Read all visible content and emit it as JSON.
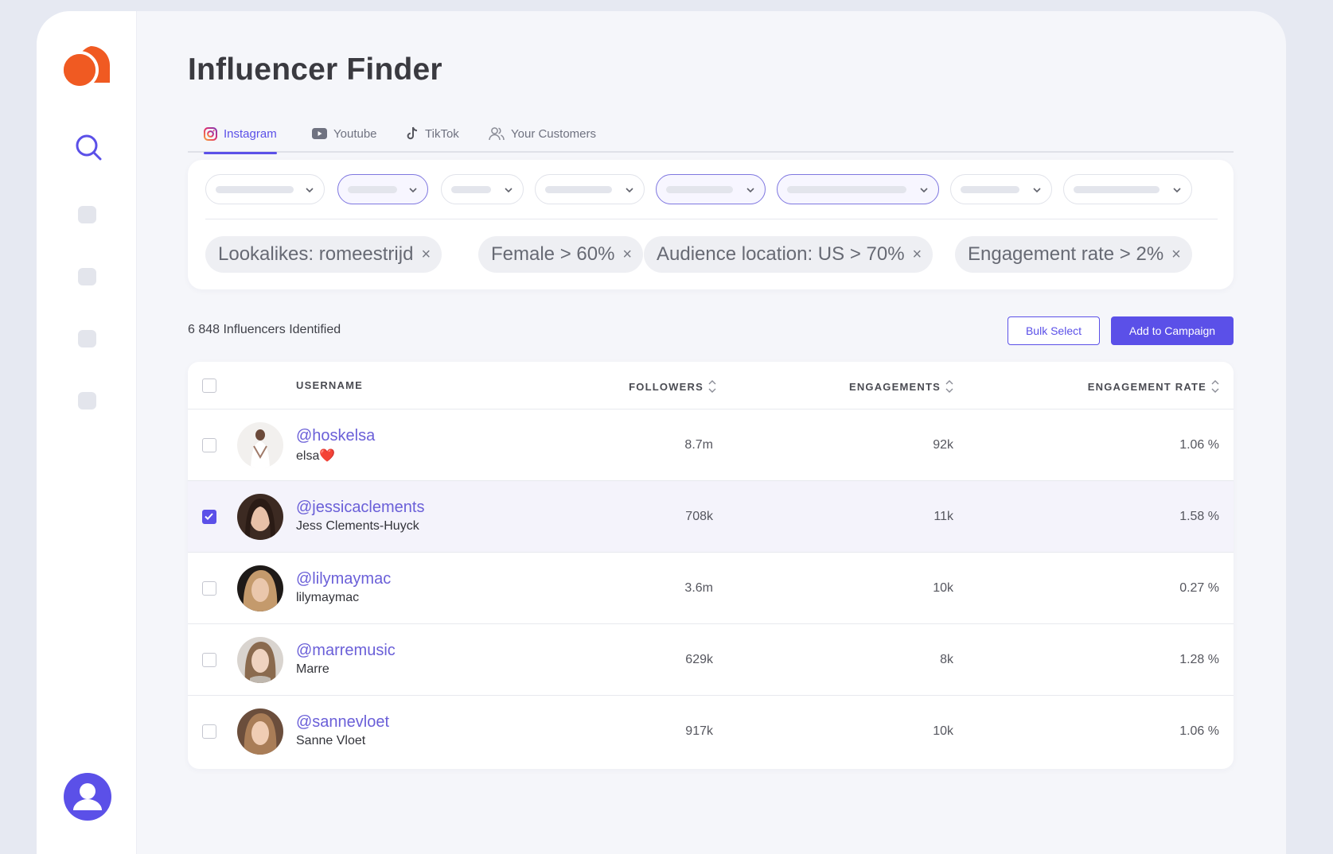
{
  "page": {
    "title": "Influencer Finder"
  },
  "colors": {
    "accent": "#5b50e8",
    "logo": "#f05a22"
  },
  "sidebar": {
    "logo_icon": "chat-bubble-logo",
    "search_icon": "search-icon",
    "user_icon": "user-avatar-icon"
  },
  "tabs": [
    {
      "label": "Instagram",
      "icon": "instagram-icon",
      "active": true
    },
    {
      "label": "Youtube",
      "icon": "youtube-icon",
      "active": false
    },
    {
      "label": "TikTok",
      "icon": "tiktok-icon",
      "active": false
    },
    {
      "label": "Your Customers",
      "icon": "users-icon",
      "active": false
    }
  ],
  "filters": {
    "chips": [
      {
        "label": "Lookalikes: romeestrijd"
      },
      {
        "label": "Female > 60%"
      },
      {
        "label": "Audience location: US > 70%"
      },
      {
        "label": "Engagement rate > 2%"
      }
    ],
    "chip_remove": "×"
  },
  "results": {
    "count_text": "6 848 Influencers Identified",
    "bulk_select": "Bulk Select",
    "add_to_campaign": "Add to Campaign"
  },
  "table": {
    "headers": {
      "username": "USERNAME",
      "followers": "FOLLOWERS",
      "engagements": "ENGAGEMENTS",
      "engagement_rate": "ENGAGEMENT RATE"
    },
    "rows": [
      {
        "handle": "@hoskelsa",
        "name": "elsa❤️",
        "followers": "8.7m",
        "engagements": "92k",
        "rate": "1.06 %",
        "checked": false
      },
      {
        "handle": "@jessicaclements",
        "name": "Jess Clements-Huyck",
        "followers": "708k",
        "engagements": "11k",
        "rate": "1.58 %",
        "checked": true
      },
      {
        "handle": "@lilymaymac",
        "name": "lilymaymac",
        "followers": "3.6m",
        "engagements": "10k",
        "rate": "0.27 %",
        "checked": false
      },
      {
        "handle": "@marremusic",
        "name": "Marre",
        "followers": "629k",
        "engagements": "8k",
        "rate": "1.28 %",
        "checked": false
      },
      {
        "handle": "@sannevloet",
        "name": "Sanne Vloet",
        "followers": "917k",
        "engagements": "10k",
        "rate": "1.06 %",
        "checked": false
      }
    ]
  }
}
